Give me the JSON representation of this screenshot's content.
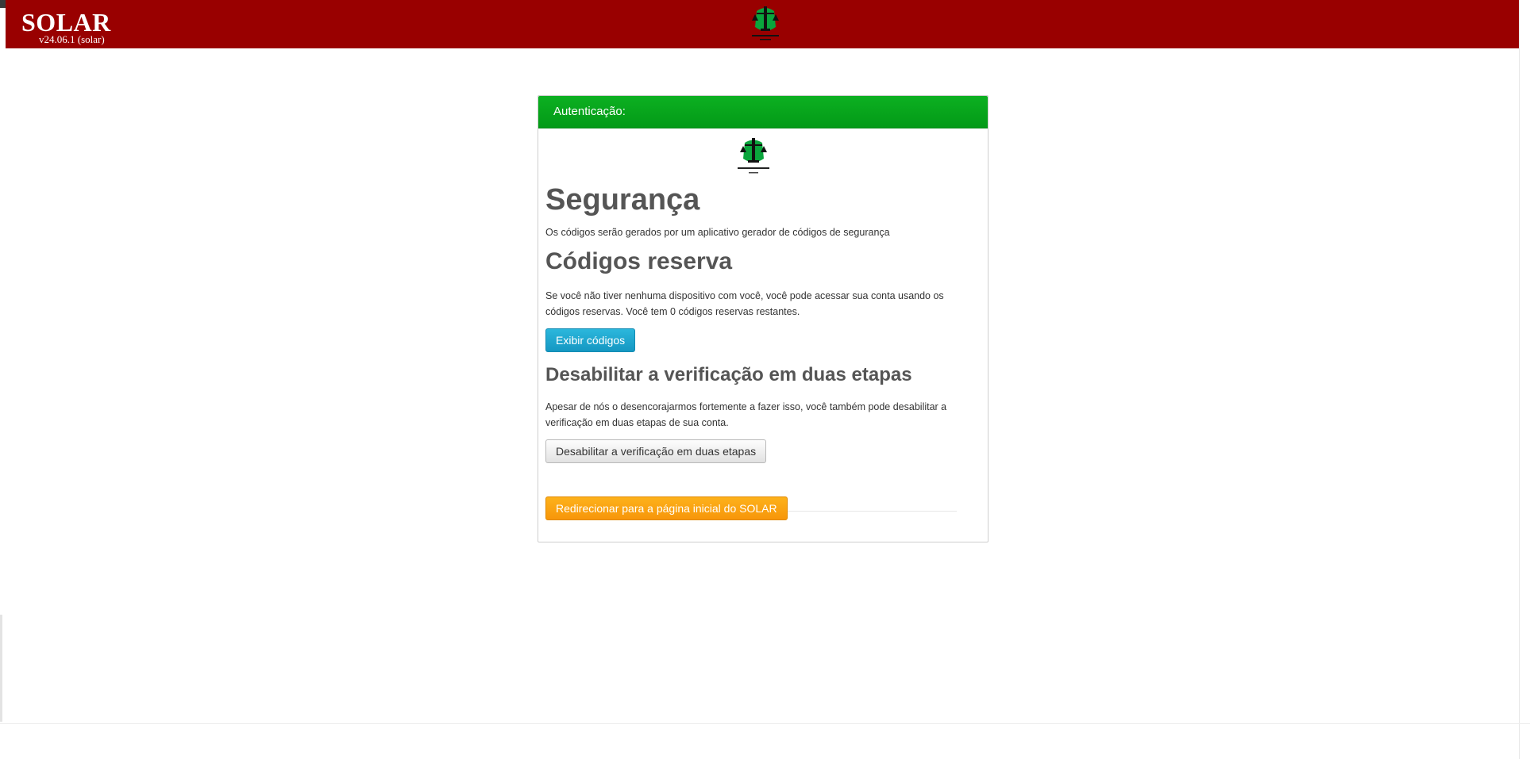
{
  "header": {
    "brand": "SOLAR",
    "version": "v24.06.1 (solar)"
  },
  "panel": {
    "header_title": "Autenticação:",
    "security": {
      "title": "Segurança",
      "description": "Os códigos serão gerados por um aplicativo gerador de códigos de segurança"
    },
    "backup_codes": {
      "title": "Códigos reserva",
      "description": "Se você não tiver nenhuma dispositivo com você, você pode acessar sua conta usando os códigos reservas. Você tem 0 códigos reservas restantes.",
      "show_button": "Exibir códigos"
    },
    "disable_2fa": {
      "title": "Desabilitar a verificação em duas etapas",
      "description": "Apesar de nós o desencorajarmos fortemente a fazer isso, você também pode desabilitar a verificação em duas etapas de sua conta.",
      "disable_button": "Desabilitar a verificação em duas etapas"
    },
    "redirect_button": "Redirecionar para a página inicial do SOLAR"
  },
  "colors": {
    "topbar": "#990000",
    "panel_header": "#039a17",
    "btn_info": "#1597c2",
    "btn_warning": "#f7960a"
  },
  "icons": {
    "top_logo": "defensoria-publica-logo",
    "panel_logo": "defensoria-publica-logo"
  }
}
